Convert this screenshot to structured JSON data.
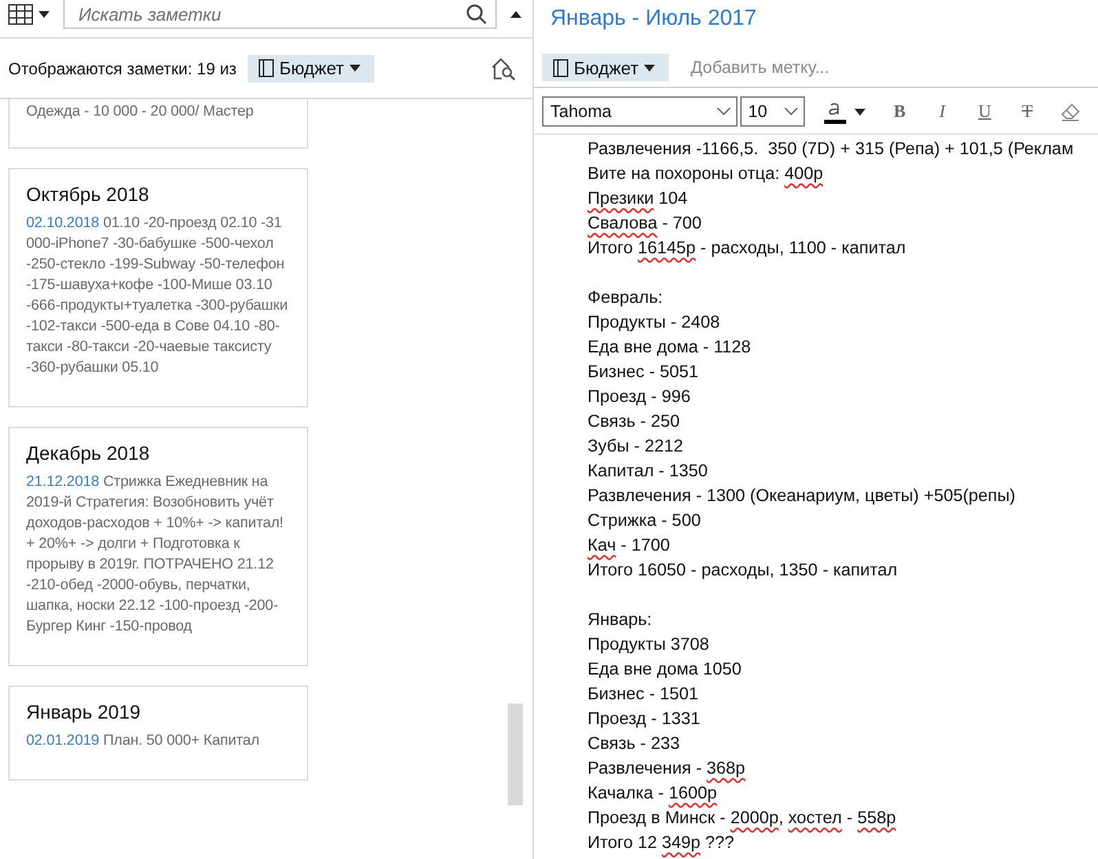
{
  "search": {
    "placeholder": "Искать заметки"
  },
  "filter": {
    "label": "Отображаются заметки: 19 из",
    "tag": "Бюджет"
  },
  "notes": [
    {
      "body": "Одежда - 10 000 - 20 000/ Мастер"
    },
    {
      "title": "Октябрь 2018",
      "date": "02.10.2018",
      "body": "01.10 -20-проезд 02.10 -31 000-iPhone7 -30-бабушке -500-чехол -250-стекло -199-Subway -50-телефон -175-шавуха+кофе -100-Мише 03.10 -666-продукты+туалетка -300-рубашки -102-такси -500-еда в Сове 04.10 -80-такси -80-такси -20-чаевые таксисту -360-рубашки 05.10"
    },
    {
      "title": "Декабрь 2018",
      "date": "21.12.2018",
      "body": "Стрижка Ежедневник на 2019-й Стратегия: Возобновить учёт доходов-расходов + 10%+ -> капитал! + 20%+ -> долги + Подготовка к прорыву в 2019г. ПОТРАЧЕНО 21.12 -210-обед -2000-обувь, перчатки, шапка, носки 22.12 -100-проезд -200-Бургер Кинг -150-провод"
    },
    {
      "title": "Январь 2019",
      "date": "02.01.2019",
      "body": "План. 50 000+ Капитал"
    }
  ],
  "editor": {
    "title": "Январь - Июль 2017",
    "tag": "Бюджет",
    "add_tag_placeholder": "Добавить метку...",
    "toolbar": {
      "font": "Tahoma",
      "size": "10",
      "buttons": [
        {
          "kind": "bold",
          "label": "B"
        },
        {
          "kind": "italic",
          "label": "I"
        },
        {
          "kind": "underline",
          "label": "U"
        },
        {
          "kind": "strike",
          "label": "T"
        },
        {
          "kind": "eraser"
        }
      ]
    },
    "lines": [
      {
        "kind": "text",
        "segments": [
          {
            "text": "Развлечения -1166,5.  350 (7D) + 315 (Репа) + 101,5 (Реклам",
            "misspelled": false
          }
        ]
      },
      {
        "kind": "text",
        "segments": [
          {
            "text": "Вите на похороны отца: ",
            "misspelled": false
          },
          {
            "text": "400р",
            "misspelled": true
          }
        ]
      },
      {
        "kind": "text",
        "segments": [
          {
            "text": "Презики",
            "misspelled": true
          },
          {
            "text": " 104",
            "misspelled": false
          }
        ]
      },
      {
        "kind": "text",
        "segments": [
          {
            "text": "Свалова",
            "misspelled": true
          },
          {
            "text": " - 700",
            "misspelled": false
          }
        ]
      },
      {
        "kind": "text",
        "segments": [
          {
            "text": "Итого ",
            "misspelled": false
          },
          {
            "text": "16145р",
            "misspelled": true
          },
          {
            "text": " - расходы, 1100 - капитал",
            "misspelled": false
          }
        ]
      },
      {
        "kind": "blank"
      },
      {
        "kind": "text",
        "segments": [
          {
            "text": "Февраль:",
            "misspelled": false
          }
        ]
      },
      {
        "kind": "text",
        "segments": [
          {
            "text": "Продукты - 2408",
            "misspelled": false
          }
        ]
      },
      {
        "kind": "text",
        "segments": [
          {
            "text": "Еда вне дома - 1128",
            "misspelled": false
          }
        ]
      },
      {
        "kind": "text",
        "segments": [
          {
            "text": "Бизнес - 5051",
            "misspelled": false
          }
        ]
      },
      {
        "kind": "text",
        "segments": [
          {
            "text": "Проезд - 996",
            "misspelled": false
          }
        ]
      },
      {
        "kind": "text",
        "segments": [
          {
            "text": "Связь - 250",
            "misspelled": false
          }
        ]
      },
      {
        "kind": "text",
        "segments": [
          {
            "text": "Зубы - 2212",
            "misspelled": false
          }
        ]
      },
      {
        "kind": "text",
        "segments": [
          {
            "text": "Капитал - 1350",
            "misspelled": false
          }
        ]
      },
      {
        "kind": "text",
        "segments": [
          {
            "text": "Развлечения - 1300 (Океанариум, цветы) +505(репы)",
            "misspelled": false
          }
        ]
      },
      {
        "kind": "text",
        "segments": [
          {
            "text": "Стрижка - 500",
            "misspelled": false
          }
        ]
      },
      {
        "kind": "text",
        "segments": [
          {
            "text": "Кач",
            "misspelled": true
          },
          {
            "text": " - 1700",
            "misspelled": false
          }
        ]
      },
      {
        "kind": "text",
        "segments": [
          {
            "text": "Итого 16050 - расходы, 1350 - капитал",
            "misspelled": false
          }
        ]
      },
      {
        "kind": "blank"
      },
      {
        "kind": "text",
        "segments": [
          {
            "text": "Январь:",
            "misspelled": false
          }
        ]
      },
      {
        "kind": "text",
        "segments": [
          {
            "text": "Продукты 3708",
            "misspelled": false
          }
        ]
      },
      {
        "kind": "text",
        "segments": [
          {
            "text": "Еда вне дома 1050",
            "misspelled": false
          }
        ]
      },
      {
        "kind": "text",
        "segments": [
          {
            "text": "Бизнес - 1501",
            "misspelled": false
          }
        ]
      },
      {
        "kind": "text",
        "segments": [
          {
            "text": "Проезд - 1331",
            "misspelled": false
          }
        ]
      },
      {
        "kind": "text",
        "segments": [
          {
            "text": "Связь - 233",
            "misspelled": false
          }
        ]
      },
      {
        "kind": "text",
        "segments": [
          {
            "text": "Развлечения - ",
            "misspelled": false
          },
          {
            "text": "368р",
            "misspelled": true
          }
        ]
      },
      {
        "kind": "text",
        "segments": [
          {
            "text": "Качалка - ",
            "misspelled": false
          },
          {
            "text": "1600р",
            "misspelled": true
          }
        ]
      },
      {
        "kind": "text",
        "segments": [
          {
            "text": "Проезд в Минск - ",
            "misspelled": false
          },
          {
            "text": "2000р",
            "misspelled": true
          },
          {
            "text": ", ",
            "misspelled": false
          },
          {
            "text": "хостел",
            "misspelled": true
          },
          {
            "text": " - ",
            "misspelled": false
          },
          {
            "text": "558р",
            "misspelled": true
          }
        ]
      },
      {
        "kind": "text",
        "segments": [
          {
            "text": "Итого 12 ",
            "misspelled": false
          },
          {
            "text": "349р",
            "misspelled": true
          },
          {
            "text": " ???",
            "misspelled": false
          }
        ]
      }
    ]
  }
}
